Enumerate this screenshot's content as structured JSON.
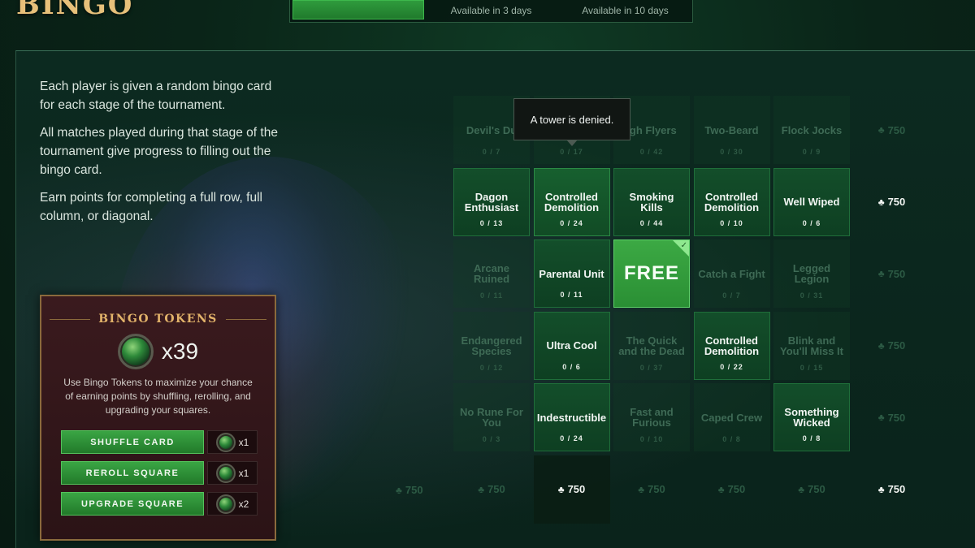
{
  "header": {
    "title": "BINGO",
    "tabs": [
      {
        "label": "",
        "active": true
      },
      {
        "label": "Available in 3 days",
        "active": false
      },
      {
        "label": "Available in 10 days",
        "active": false
      }
    ]
  },
  "intro": [
    "Each player is given a random bingo card for each stage of the tournament.",
    "All matches played during that stage of the tournament give progress to filling out the bingo card.",
    "Earn points for completing a full row, full column, or diagonal."
  ],
  "tokens": {
    "title": "BINGO TOKENS",
    "count": "x39",
    "description": "Use Bingo Tokens to maximize your chance of earning points by shuffling, rerolling, and upgrading your squares.",
    "actions": [
      {
        "label": "SHUFFLE CARD",
        "cost": "x1"
      },
      {
        "label": "REROLL SQUARE",
        "cost": "x1"
      },
      {
        "label": "UPGRADE SQUARE",
        "cost": "x2"
      }
    ]
  },
  "tooltip": "A tower is denied.",
  "grid": {
    "rows": [
      {
        "cells": [
          {
            "name": "Devil's Du",
            "progress": "0 / 7",
            "state": "inactive"
          },
          {
            "name": "",
            "progress": "0 / 17",
            "state": "inactive"
          },
          {
            "name": "igh Flyers",
            "progress": "0 / 42",
            "state": "inactive"
          },
          {
            "name": "Two-Beard",
            "progress": "0 / 30",
            "state": "inactive"
          },
          {
            "name": "Flock Jocks",
            "progress": "0 / 9",
            "state": "inactive"
          }
        ],
        "reward": "750",
        "reward_lit": false
      },
      {
        "cells": [
          {
            "name": "Dagon Enthusiast",
            "progress": "0 / 13",
            "state": "active"
          },
          {
            "name": "Controlled Demolition",
            "progress": "0 / 24",
            "state": "highlight"
          },
          {
            "name": "Smoking Kills",
            "progress": "0 / 44",
            "state": "active"
          },
          {
            "name": "Controlled Demolition",
            "progress": "0 / 10",
            "state": "active"
          },
          {
            "name": "Well Wiped",
            "progress": "0 / 6",
            "state": "active"
          }
        ],
        "reward": "750",
        "reward_lit": true
      },
      {
        "cells": [
          {
            "name": "Arcane Ruined",
            "progress": "0 / 11",
            "state": "inactive"
          },
          {
            "name": "Parental Unit",
            "progress": "0 / 11",
            "state": "active"
          },
          {
            "name": "FREE",
            "progress": "",
            "state": "free"
          },
          {
            "name": "Catch a Fight",
            "progress": "0 / 7",
            "state": "inactive"
          },
          {
            "name": "Legged Legion",
            "progress": "0 / 31",
            "state": "inactive"
          }
        ],
        "reward": "750",
        "reward_lit": false
      },
      {
        "cells": [
          {
            "name": "Endangered Species",
            "progress": "0 / 12",
            "state": "inactive"
          },
          {
            "name": "Ultra Cool",
            "progress": "0 / 6",
            "state": "active"
          },
          {
            "name": "The Quick and the Dead",
            "progress": "0 / 37",
            "state": "inactive"
          },
          {
            "name": "Controlled Demolition",
            "progress": "0 / 22",
            "state": "active"
          },
          {
            "name": "Blink and You'll Miss It",
            "progress": "0 / 15",
            "state": "inactive"
          }
        ],
        "reward": "750",
        "reward_lit": false
      },
      {
        "cells": [
          {
            "name": "No Rune For You",
            "progress": "0 / 3",
            "state": "inactive"
          },
          {
            "name": "Indestructible",
            "progress": "0 / 24",
            "state": "active"
          },
          {
            "name": "Fast and Furious",
            "progress": "0 / 10",
            "state": "inactive"
          },
          {
            "name": "Caped Crew",
            "progress": "0 / 8",
            "state": "inactive"
          },
          {
            "name": "Something Wicked",
            "progress": "0 / 8",
            "state": "active"
          }
        ],
        "reward": "750",
        "reward_lit": false
      }
    ],
    "column_rewards": [
      {
        "value": "750",
        "lit": false
      },
      {
        "value": "750",
        "lit": true
      },
      {
        "value": "750",
        "lit": false
      },
      {
        "value": "750",
        "lit": false
      },
      {
        "value": "750",
        "lit": false
      }
    ],
    "diagonal_rewards": [
      {
        "value": "750",
        "lit": false
      },
      {
        "value": "750",
        "lit": true
      }
    ]
  },
  "icons": {
    "reward": "points-icon",
    "token": "bingo-token-icon"
  }
}
